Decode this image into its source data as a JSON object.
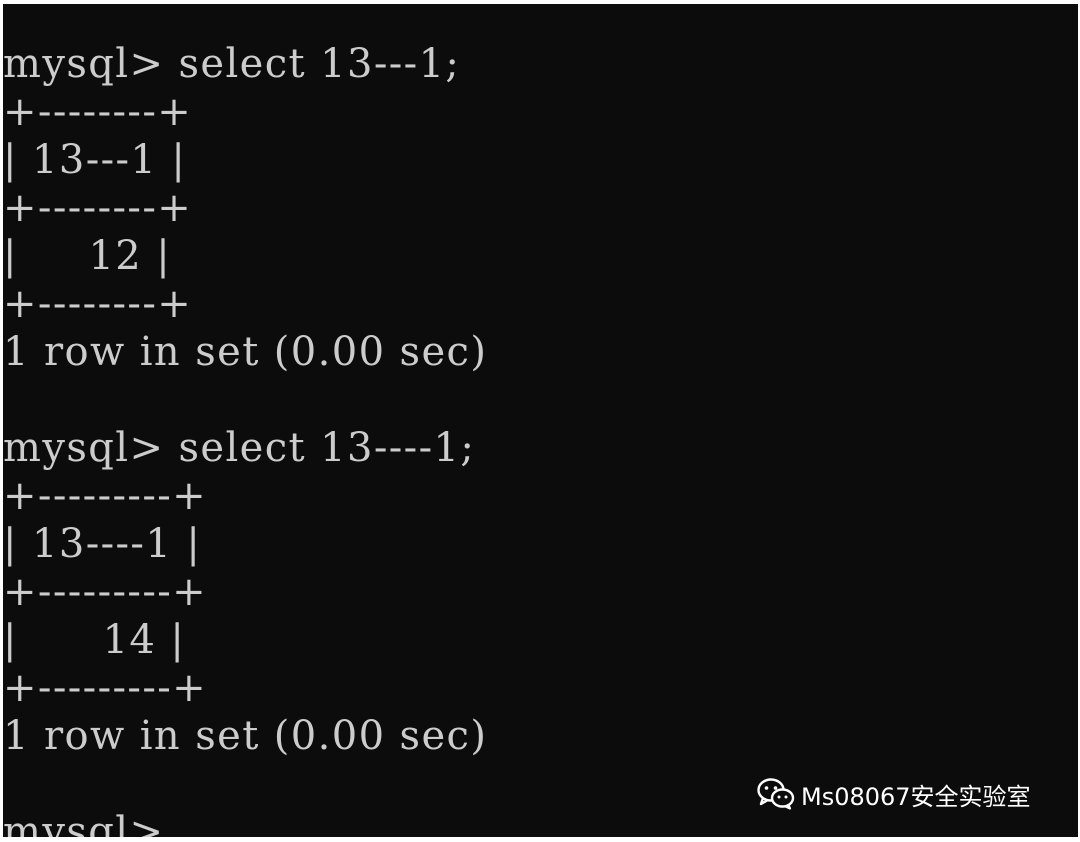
{
  "terminal": {
    "lines": [
      "mysql> select 13---1;",
      "+--------+",
      "| 13---1 |",
      "+--------+",
      "|     12 |",
      "+--------+",
      "1 row in set (0.00 sec)",
      "",
      "mysql> select 13----1;",
      "+---------+",
      "| 13----1 |",
      "+---------+",
      "|      14 |",
      "+---------+",
      "1 row in set (0.00 sec)",
      "",
      "mysql> "
    ]
  },
  "watermark": {
    "icon": "wechat-icon",
    "text": "Ms08067安全实验室"
  }
}
